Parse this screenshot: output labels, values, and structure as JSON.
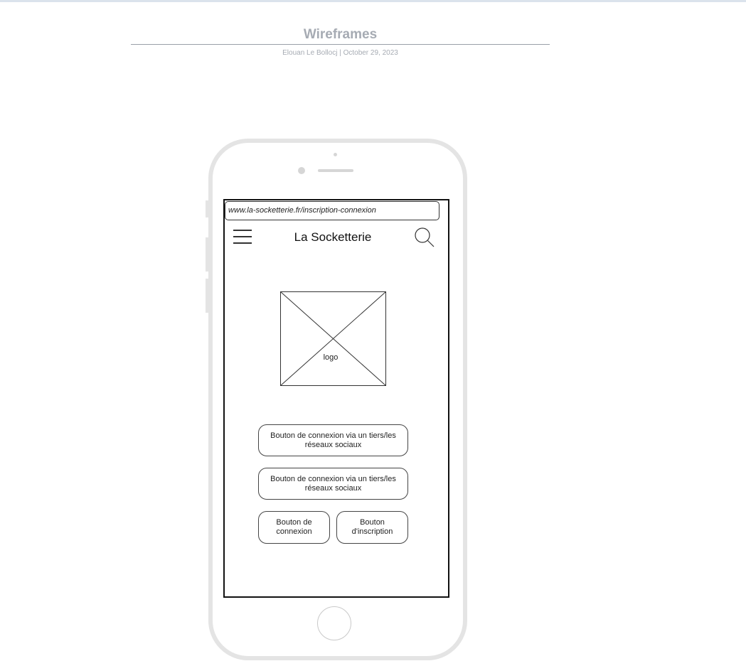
{
  "document": {
    "title": "Wireframes",
    "meta": "Elouan Le Bollocj  |  October 29, 2023"
  },
  "screen": {
    "url": "www.la-socketterie.fr/inscription-connexion",
    "site_name": "La Socketterie",
    "logo_label": "logo"
  },
  "buttons": {
    "social_1": "Bouton de connexion via un tiers/les réseaux sociaux",
    "social_2": "Bouton de connexion via un tiers/les réseaux sociaux",
    "login": "Bouton de connexion",
    "signup": "Bouton d'inscription"
  },
  "icons": {
    "menu": "hamburger-menu-icon",
    "search": "search-icon",
    "logo": "image-placeholder-icon"
  },
  "colors": {
    "title_gray": "#a6abb3",
    "phone_frame": "#e4e4e4",
    "wire_stroke": "#333333"
  }
}
